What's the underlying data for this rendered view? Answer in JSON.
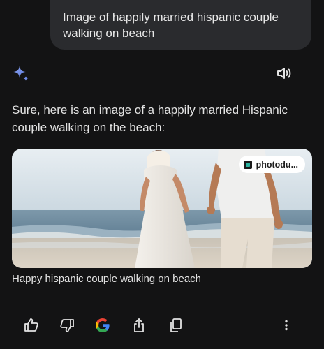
{
  "user_message": {
    "text": "Image of happily married hispanic couple walking on beach"
  },
  "assistant": {
    "icon": "gemini-spark-icon",
    "speak_icon": "speaker-icon",
    "response": "Sure, here is an image of a happily married Hispanic couple walking on the beach:",
    "image": {
      "source_label": "photodu...",
      "caption": "Happy hispanic couple walking on beach"
    }
  },
  "actions": {
    "icons": [
      "thumbs-up-icon",
      "thumbs-down-icon",
      "google-icon",
      "share-icon",
      "copy-icon",
      "more-vert-icon"
    ]
  },
  "colors": {
    "background": "#131314",
    "bubble": "#2a2b2e",
    "text": "#e3e3e3",
    "spark": "#6f8be8"
  }
}
